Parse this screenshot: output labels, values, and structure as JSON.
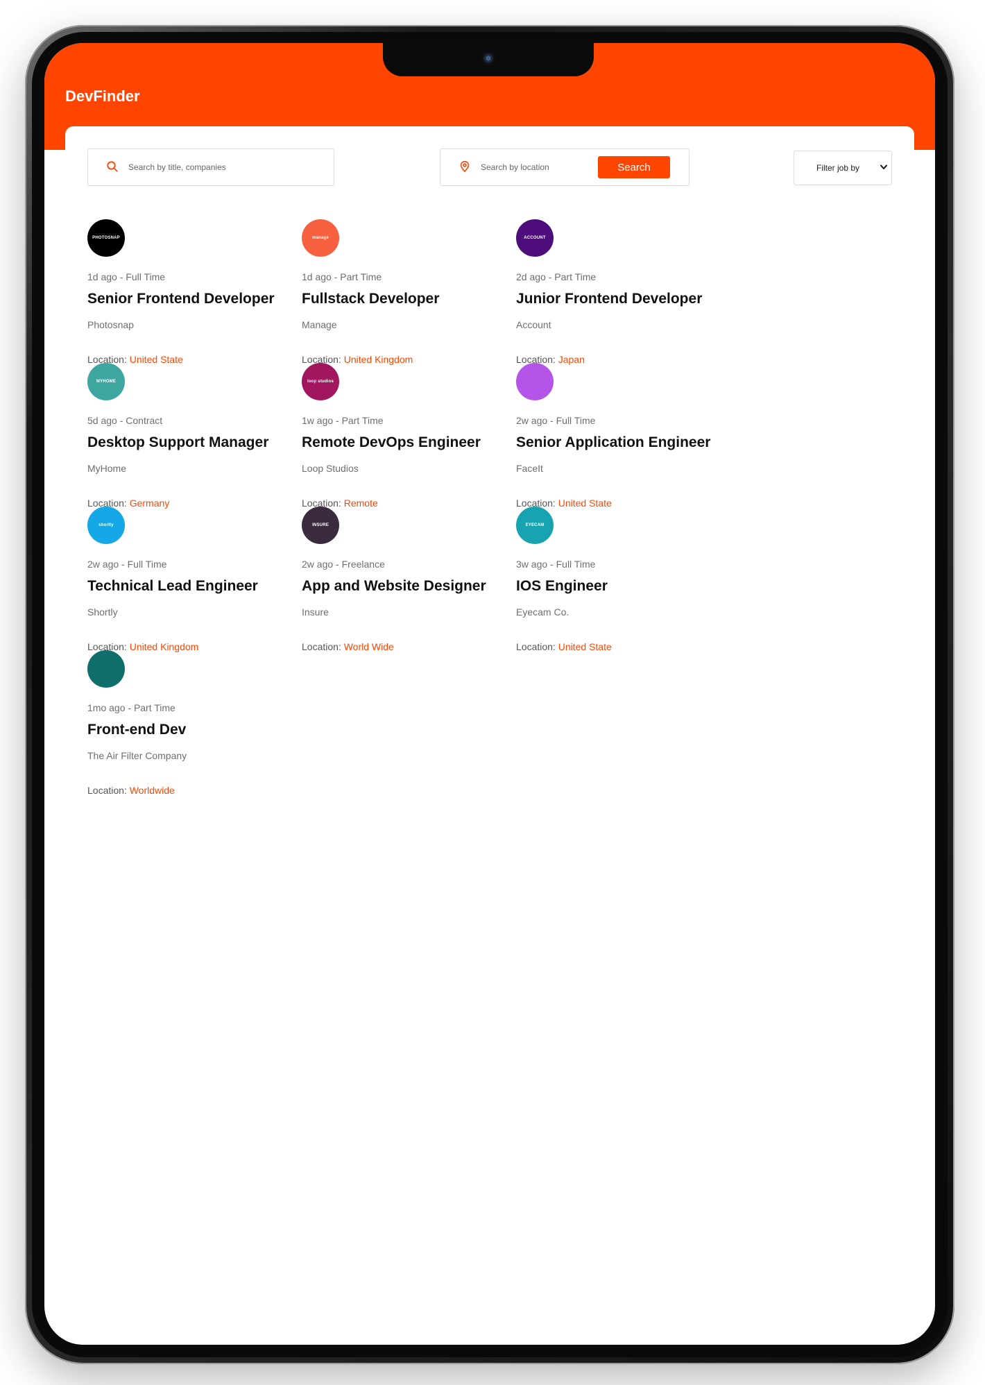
{
  "app": {
    "brand": "DevFinder"
  },
  "search": {
    "title_placeholder": "Search by title, companies",
    "location_placeholder": "Search by location",
    "button_label": "Search",
    "filter_label": "Filter job by"
  },
  "colors": {
    "accent": "#ff4500"
  },
  "location_prefix": "Location:",
  "jobs": [
    {
      "posted": "1d ago",
      "type": "Full Time",
      "title": "Senior Frontend Developer",
      "company": "Photosnap",
      "location": "United State",
      "logo_text": "PHOTOSNAP",
      "logo_color": "#000000"
    },
    {
      "posted": "1d ago",
      "type": "Part Time",
      "title": "Fullstack Developer",
      "company": "Manage",
      "location": "United Kingdom",
      "logo_text": "manage",
      "logo_color": "#f7613f"
    },
    {
      "posted": "2d ago",
      "type": "Part Time",
      "title": "Junior Frontend Developer",
      "company": "Account",
      "location": "Japan",
      "logo_text": "ACCOUNT",
      "logo_color": "#4d0d7a"
    },
    {
      "posted": "5d ago",
      "type": "Contract",
      "title": "Desktop Support Manager",
      "company": "MyHome",
      "location": "Germany",
      "logo_text": "MYHOME",
      "logo_color": "#3ea6a0"
    },
    {
      "posted": "1w ago",
      "type": "Part Time",
      "title": "Remote DevOps Engineer",
      "company": "Loop Studios",
      "location": "Remote",
      "logo_text": "loop studios",
      "logo_color": "#a1165f"
    },
    {
      "posted": "2w ago",
      "type": "Full Time",
      "title": "Senior Application Engineer",
      "company": "FaceIt",
      "location": "United State",
      "logo_text": "",
      "logo_color": "#b454e8"
    },
    {
      "posted": "2w ago",
      "type": "Full Time",
      "title": "Technical Lead Engineer",
      "company": "Shortly",
      "location": "United Kingdom",
      "logo_text": "shortly",
      "logo_color": "#14a8e6"
    },
    {
      "posted": "2w ago",
      "type": "Freelance",
      "title": "App and Website Designer",
      "company": "Insure",
      "location": "World Wide",
      "logo_text": "INSURE",
      "logo_color": "#3b2b3f"
    },
    {
      "posted": "3w ago",
      "type": "Full Time",
      "title": "IOS Engineer",
      "company": "Eyecam Co.",
      "location": "United State",
      "logo_text": "EYECAM",
      "logo_color": "#17a4b0"
    },
    {
      "posted": "1mo ago",
      "type": "Part Time",
      "title": "Front-end Dev",
      "company": "The Air Filter Company",
      "location": "Worldwide",
      "logo_text": "",
      "logo_color": "#0d6e6c"
    }
  ]
}
